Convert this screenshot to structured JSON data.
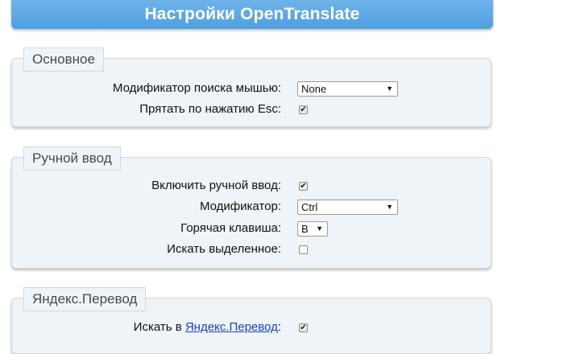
{
  "header": {
    "title": "Настройки OpenTranslate"
  },
  "sections": {
    "main": {
      "title": "Основное",
      "mouse_modifier": {
        "label": "Модификатор поиска мышью:",
        "value": "None"
      },
      "hide_esc": {
        "label": "Прятать по нажатию Esc:",
        "checked": true
      }
    },
    "manual": {
      "title": "Ручной ввод",
      "enable": {
        "label": "Включить ручной ввод:",
        "checked": true
      },
      "modifier": {
        "label": "Модификатор:",
        "value": "Ctrl"
      },
      "hotkey": {
        "label": "Горячая клавиша:",
        "value": "B"
      },
      "search_selected": {
        "label": "Искать выделенное:",
        "checked": false
      }
    },
    "yandex": {
      "title": "Яндекс.Перевод",
      "search_in": {
        "label_prefix": "Искать в ",
        "link": "Яндекс.Перевод",
        "label_suffix": ":",
        "checked": true
      }
    }
  }
}
